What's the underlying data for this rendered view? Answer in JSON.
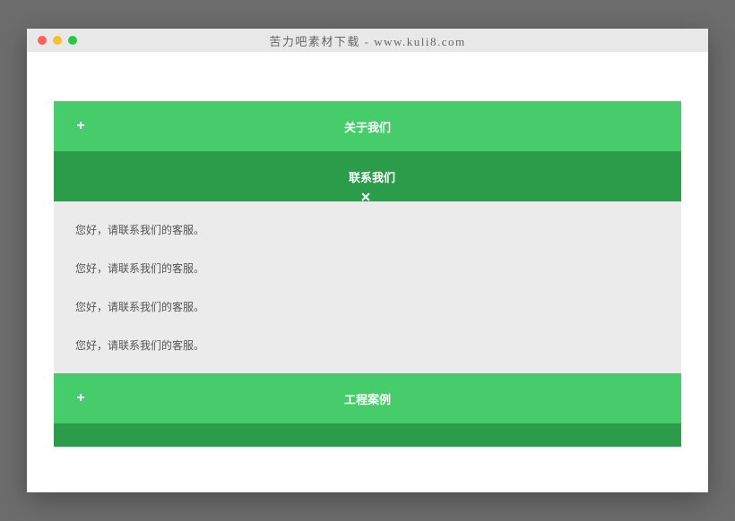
{
  "window": {
    "title": "苦力吧素材下载 - www.kuli8.com"
  },
  "accordion": {
    "items": [
      {
        "label": "关于我们",
        "expanded": false
      },
      {
        "label": "联系我们",
        "expanded": true,
        "lines": [
          "您好，请联系我们的客服。",
          "您好，请联系我们的客服。",
          "您好，请联系我们的客服。",
          "您好，请联系我们的客服。"
        ]
      },
      {
        "label": "工程案例",
        "expanded": false
      }
    ]
  },
  "colors": {
    "header_collapsed": "#46cc6b",
    "header_expanded": "#2b9d4a",
    "body_bg": "#ebebeb"
  }
}
